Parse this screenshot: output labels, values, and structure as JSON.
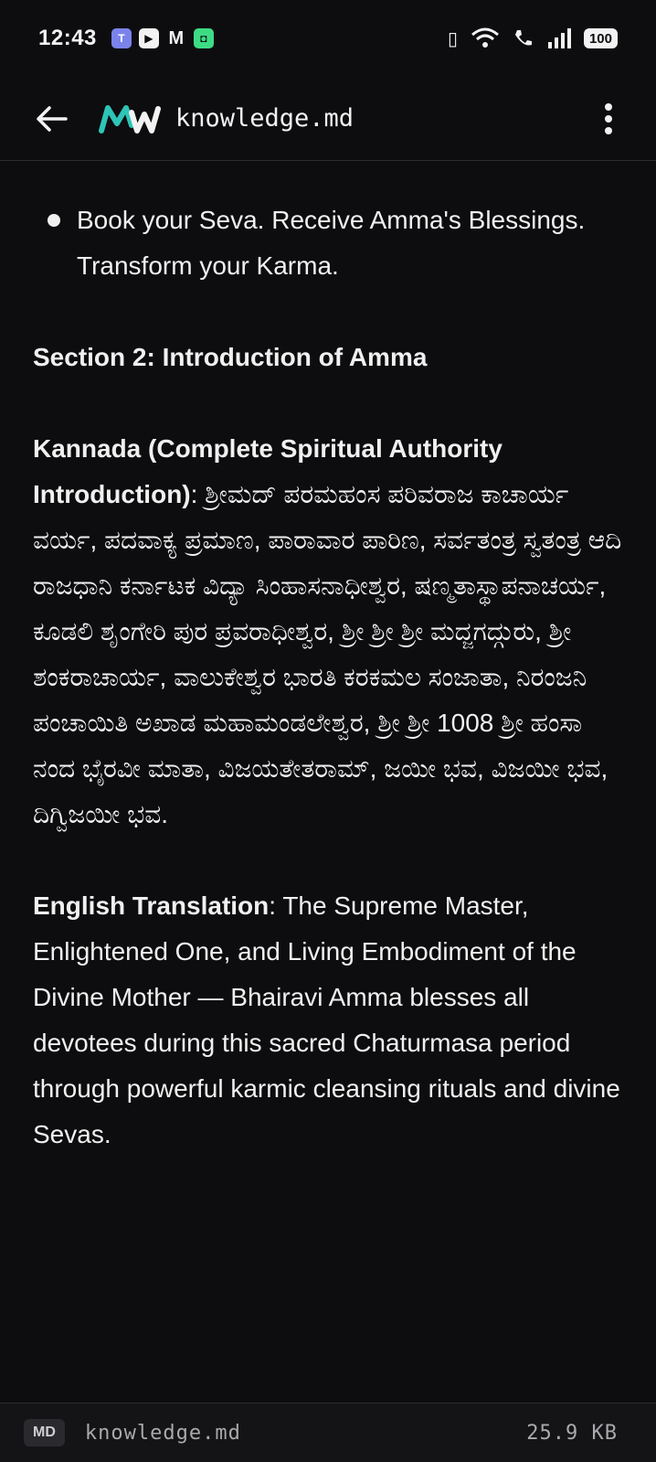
{
  "status_bar": {
    "time": "12:43",
    "notifications": [
      "teams-icon",
      "youtube-icon",
      "gmail-icon",
      "android-app-icon"
    ],
    "battery": "100"
  },
  "app_bar": {
    "title": "knowledge.md",
    "logo_color": "#2ec4b6"
  },
  "content": {
    "bullet": "Book your Seva. Receive Amma's Blessings. Transform your Karma.",
    "section_heading": "Section 2: Introduction of Amma",
    "kannada_label": "Kannada (Complete Spiritual Authority Introduction)",
    "kannada_text": ": ಶ್ರೀಮದ್ ಪರಮಹಂಸ ಪರಿವರಾಜ ಕಾಚಾರ್ಯ ವರ್ಯ, ಪದವಾಕ್ಯ ಪ್ರಮಾಣ, ಪಾರಾವಾರ ಪಾರಿಣ, ಸರ್ವತಂತ್ರ ಸ್ವತಂತ್ರ ಆದಿ ರಾಜಧಾನಿ ಕರ್ನಾಟಕ ವಿದ್ಯಾ ಸಿಂಹಾಸನಾಧೀಶ್ವರ, ಷಣ್ಮತಾಸ್ಥಾಪನಾಚರ್ಯ, ಕೂಡಲಿ ಶೃಂಗೇರಿ ಪುರ ಪ್ರವರಾಧೀಶ್ವರ, ಶ್ರೀ ಶ್ರೀ ಶ್ರೀ ಮದ್ಜಗದ್ಗುರು, ಶ್ರೀ ಶಂಕರಾಚಾರ್ಯ, ವಾಲುಕೇಶ್ವರ ಭಾರತಿ ಕರಕಮಲ ಸಂಜಾತಾ, ನಿರಂಜನಿ ಪಂಚಾಯಿತಿ ಅಖಾಡ ಮಹಾಮಂಡಲೇಶ್ವರ, ಶ್ರೀ ಶ್ರೀ 1008 ಶ್ರೀ ಹಂಸಾ ನಂದ ಭೈರವೀ ಮಾತಾ, ವಿಜಯತೇತರಾಮ್, ಜಯೀ ಭವ, ವಿಜಯೀ ಭವ, ದಿಗ್ವಿಜಯೀ ಭವ.",
    "english_label": "English Translation",
    "english_text": ": The Supreme Master, Enlightened One, and Living Embodiment of the Divine Mother — Bhairavi Amma blesses all devotees during this sacred Chaturmasa period through powerful karmic cleansing rituals and divine Sevas."
  },
  "footer": {
    "badge": "MD",
    "file_name": "knowledge.md",
    "file_size": "25.9 KB"
  }
}
